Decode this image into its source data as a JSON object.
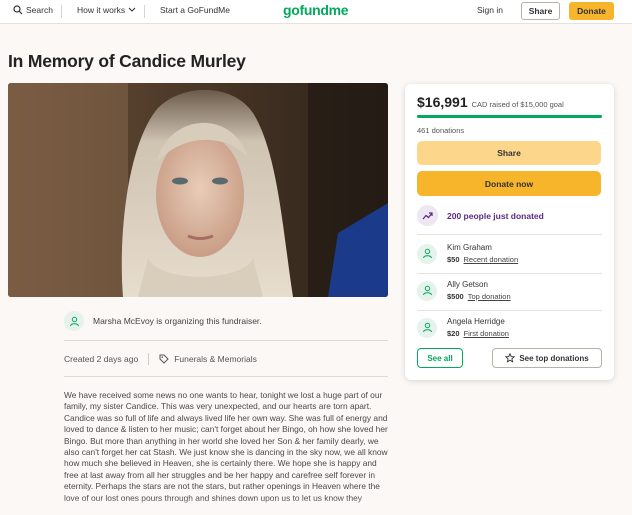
{
  "nav": {
    "search_label": "Search",
    "how_it_works_label": "How it works",
    "start_label": "Start a GoFundMe",
    "logo_text": "gofundme",
    "signin_label": "Sign in",
    "share_label": "Share",
    "donate_label": "Donate"
  },
  "campaign": {
    "title": "In Memory of Candice Murley",
    "organizer_text": "Marsha McEvoy is organizing this fundraiser.",
    "created_text": "Created 2 days ago",
    "category": "Funerals & Memorials",
    "story": "We have received some news no one wants to hear, tonight we lost a huge part of our family, my sister Candice. This was very unexpected, and our hearts are torn apart. Candice was so full of life and always lived life her own way. She was full of energy and loved to dance & listen to her music; can't forget about her Bingo, oh how she loved her Bingo. But more than anything in her world she loved her Son & her family dearly, we also can't forget her cat Stash. We just know she is dancing in the sky now, we all know how much she believed in Heaven, she is certainly there. We hope she is happy and free at last away from all her struggles and be her happy and carefree self forever in eternity. Perhaps the stars are not the stars, but rather openings in Heaven where the love of our lost ones pours through and shines down upon us to let us know they"
  },
  "sidebar": {
    "raised_amount": "$16,991",
    "goal_text": "CAD raised of $15,000 goal",
    "progress_fraction": 1.0,
    "donations_count": "461 donations",
    "share_label": "Share",
    "donate_label": "Donate now",
    "trending_text": "200 people just donated",
    "donors": [
      {
        "name": "Kim Graham",
        "amount": "$50",
        "tag": "Recent donation"
      },
      {
        "name": "Ally Getson",
        "amount": "$500",
        "tag": "Top donation"
      },
      {
        "name": "Angela Herridge",
        "amount": "$20",
        "tag": "First donation"
      }
    ],
    "see_all_label": "See all",
    "see_top_label": "See top donations"
  },
  "colors": {
    "brand_green": "#02a95c",
    "donate_orange": "#f7b52b",
    "share_yellow": "#fcd68a",
    "trending_purple": "#5b2a86"
  }
}
